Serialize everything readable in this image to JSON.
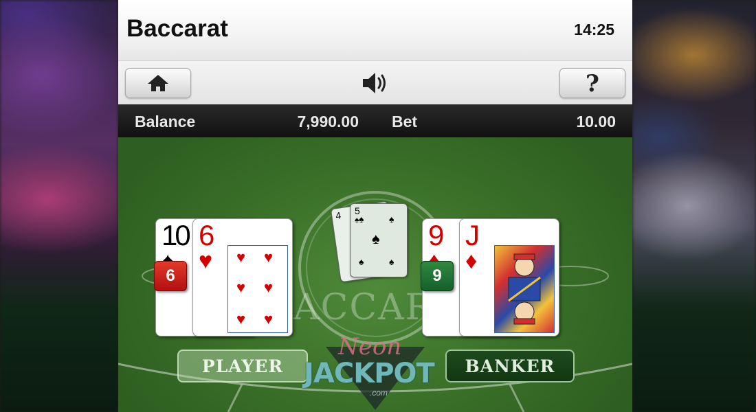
{
  "header": {
    "title": "Baccarat",
    "time": "14:25"
  },
  "toolbar": {
    "home_icon": "home-icon",
    "sound_icon": "speaker-icon",
    "help_label": "?"
  },
  "info": {
    "balance_label": "Balance",
    "balance_value": "7,990.00",
    "bet_label": "Bet",
    "bet_value": "10.00"
  },
  "table": {
    "felt_text": "ACCAR",
    "player": {
      "score": "6",
      "cards": [
        {
          "rank": "10",
          "suit": "♠"
        },
        {
          "rank": "6",
          "suit": "♥"
        }
      ],
      "bet_label": "PLAYER"
    },
    "banker": {
      "score": "9",
      "cards": [
        {
          "rank": "9",
          "suit": "♦"
        },
        {
          "rank": "J",
          "suit": "♦"
        }
      ],
      "bet_label": "BANKER"
    },
    "deck": {
      "back_rank": "4",
      "front_rank": "5",
      "suit": "♠"
    }
  },
  "watermark": {
    "line1": "Neon",
    "line2": "JACKPOT",
    "line3": ".com"
  },
  "colors": {
    "felt": "#3a7028",
    "player_score": "#c8221a",
    "banker_score": "#1f7034",
    "accent_red": "#d40000"
  }
}
